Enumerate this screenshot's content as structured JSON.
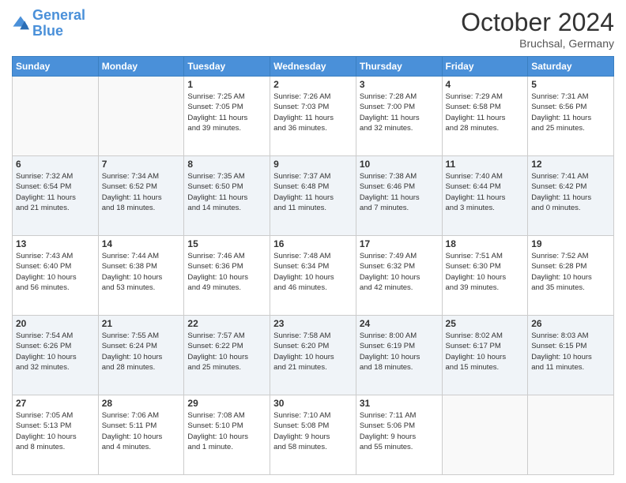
{
  "header": {
    "logo_line1": "General",
    "logo_line2": "Blue",
    "month_title": "October 2024",
    "location": "Bruchsal, Germany"
  },
  "weekdays": [
    "Sunday",
    "Monday",
    "Tuesday",
    "Wednesday",
    "Thursday",
    "Friday",
    "Saturday"
  ],
  "weeks": [
    [
      {
        "day": "",
        "info": ""
      },
      {
        "day": "",
        "info": ""
      },
      {
        "day": "1",
        "info": "Sunrise: 7:25 AM\nSunset: 7:05 PM\nDaylight: 11 hours\nand 39 minutes."
      },
      {
        "day": "2",
        "info": "Sunrise: 7:26 AM\nSunset: 7:03 PM\nDaylight: 11 hours\nand 36 minutes."
      },
      {
        "day": "3",
        "info": "Sunrise: 7:28 AM\nSunset: 7:00 PM\nDaylight: 11 hours\nand 32 minutes."
      },
      {
        "day": "4",
        "info": "Sunrise: 7:29 AM\nSunset: 6:58 PM\nDaylight: 11 hours\nand 28 minutes."
      },
      {
        "day": "5",
        "info": "Sunrise: 7:31 AM\nSunset: 6:56 PM\nDaylight: 11 hours\nand 25 minutes."
      }
    ],
    [
      {
        "day": "6",
        "info": "Sunrise: 7:32 AM\nSunset: 6:54 PM\nDaylight: 11 hours\nand 21 minutes."
      },
      {
        "day": "7",
        "info": "Sunrise: 7:34 AM\nSunset: 6:52 PM\nDaylight: 11 hours\nand 18 minutes."
      },
      {
        "day": "8",
        "info": "Sunrise: 7:35 AM\nSunset: 6:50 PM\nDaylight: 11 hours\nand 14 minutes."
      },
      {
        "day": "9",
        "info": "Sunrise: 7:37 AM\nSunset: 6:48 PM\nDaylight: 11 hours\nand 11 minutes."
      },
      {
        "day": "10",
        "info": "Sunrise: 7:38 AM\nSunset: 6:46 PM\nDaylight: 11 hours\nand 7 minutes."
      },
      {
        "day": "11",
        "info": "Sunrise: 7:40 AM\nSunset: 6:44 PM\nDaylight: 11 hours\nand 3 minutes."
      },
      {
        "day": "12",
        "info": "Sunrise: 7:41 AM\nSunset: 6:42 PM\nDaylight: 11 hours\nand 0 minutes."
      }
    ],
    [
      {
        "day": "13",
        "info": "Sunrise: 7:43 AM\nSunset: 6:40 PM\nDaylight: 10 hours\nand 56 minutes."
      },
      {
        "day": "14",
        "info": "Sunrise: 7:44 AM\nSunset: 6:38 PM\nDaylight: 10 hours\nand 53 minutes."
      },
      {
        "day": "15",
        "info": "Sunrise: 7:46 AM\nSunset: 6:36 PM\nDaylight: 10 hours\nand 49 minutes."
      },
      {
        "day": "16",
        "info": "Sunrise: 7:48 AM\nSunset: 6:34 PM\nDaylight: 10 hours\nand 46 minutes."
      },
      {
        "day": "17",
        "info": "Sunrise: 7:49 AM\nSunset: 6:32 PM\nDaylight: 10 hours\nand 42 minutes."
      },
      {
        "day": "18",
        "info": "Sunrise: 7:51 AM\nSunset: 6:30 PM\nDaylight: 10 hours\nand 39 minutes."
      },
      {
        "day": "19",
        "info": "Sunrise: 7:52 AM\nSunset: 6:28 PM\nDaylight: 10 hours\nand 35 minutes."
      }
    ],
    [
      {
        "day": "20",
        "info": "Sunrise: 7:54 AM\nSunset: 6:26 PM\nDaylight: 10 hours\nand 32 minutes."
      },
      {
        "day": "21",
        "info": "Sunrise: 7:55 AM\nSunset: 6:24 PM\nDaylight: 10 hours\nand 28 minutes."
      },
      {
        "day": "22",
        "info": "Sunrise: 7:57 AM\nSunset: 6:22 PM\nDaylight: 10 hours\nand 25 minutes."
      },
      {
        "day": "23",
        "info": "Sunrise: 7:58 AM\nSunset: 6:20 PM\nDaylight: 10 hours\nand 21 minutes."
      },
      {
        "day": "24",
        "info": "Sunrise: 8:00 AM\nSunset: 6:19 PM\nDaylight: 10 hours\nand 18 minutes."
      },
      {
        "day": "25",
        "info": "Sunrise: 8:02 AM\nSunset: 6:17 PM\nDaylight: 10 hours\nand 15 minutes."
      },
      {
        "day": "26",
        "info": "Sunrise: 8:03 AM\nSunset: 6:15 PM\nDaylight: 10 hours\nand 11 minutes."
      }
    ],
    [
      {
        "day": "27",
        "info": "Sunrise: 7:05 AM\nSunset: 5:13 PM\nDaylight: 10 hours\nand 8 minutes."
      },
      {
        "day": "28",
        "info": "Sunrise: 7:06 AM\nSunset: 5:11 PM\nDaylight: 10 hours\nand 4 minutes."
      },
      {
        "day": "29",
        "info": "Sunrise: 7:08 AM\nSunset: 5:10 PM\nDaylight: 10 hours\nand 1 minute."
      },
      {
        "day": "30",
        "info": "Sunrise: 7:10 AM\nSunset: 5:08 PM\nDaylight: 9 hours\nand 58 minutes."
      },
      {
        "day": "31",
        "info": "Sunrise: 7:11 AM\nSunset: 5:06 PM\nDaylight: 9 hours\nand 55 minutes."
      },
      {
        "day": "",
        "info": ""
      },
      {
        "day": "",
        "info": ""
      }
    ]
  ]
}
